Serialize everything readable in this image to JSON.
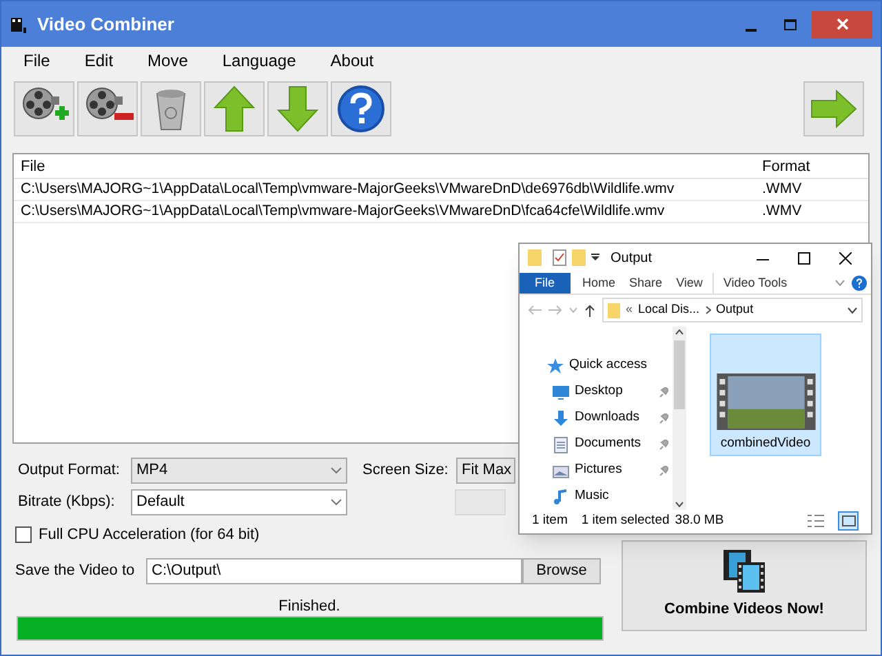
{
  "window": {
    "title": "Video Combiner"
  },
  "menu": [
    "File",
    "Edit",
    "Move",
    "Language",
    "About"
  ],
  "toolbar": [
    {
      "kind": "add"
    },
    {
      "kind": "remove"
    },
    {
      "kind": "clear"
    },
    {
      "kind": "up"
    },
    {
      "kind": "down"
    },
    {
      "kind": "help"
    }
  ],
  "file_list": {
    "columns": [
      "File",
      "Format"
    ],
    "rows": [
      {
        "file": "C:\\Users\\MAJORG~1\\AppData\\Local\\Temp\\vmware-MajorGeeks\\VMwareDnD\\de6976db\\Wildlife.wmv",
        "format": ".WMV"
      },
      {
        "file": "C:\\Users\\MAJORG~1\\AppData\\Local\\Temp\\vmware-MajorGeeks\\VMwareDnD\\fca64cfe\\Wildlife.wmv",
        "format": ".WMV"
      }
    ]
  },
  "output_format": {
    "label": "Output Format:",
    "value": "MP4"
  },
  "screen_size": {
    "label": "Screen Size:",
    "value": "Fit Max"
  },
  "bitrate": {
    "label": "Bitrate (Kbps):",
    "value": "Default"
  },
  "cpu_acceleration": {
    "label": "Full CPU Acceleration (for 64 bit)",
    "checked": false
  },
  "save_to": {
    "label": "Save the Video to",
    "value": "C:\\Output\\",
    "button": "Browse"
  },
  "status": "Finished.",
  "progress": {
    "level": 1
  },
  "combine_button": "Combine Videos Now!",
  "explorer": {
    "title": "Output",
    "ribbon_tabs": [
      {
        "label": "File",
        "selected": true
      },
      {
        "label": "Home",
        "selected": false
      },
      {
        "label": "Share",
        "selected": false
      },
      {
        "label": "View",
        "selected": false
      },
      {
        "label": "Video Tools",
        "selected": false
      }
    ],
    "breadcrumb": {
      "prefix": "«",
      "parts": [
        "Local Dis...",
        "Output"
      ]
    },
    "nav": [
      {
        "label": "Quick access",
        "kind": "star",
        "pinned": false
      },
      {
        "label": "Desktop",
        "kind": "desktop",
        "pinned": true
      },
      {
        "label": "Downloads",
        "kind": "download",
        "pinned": true
      },
      {
        "label": "Documents",
        "kind": "document",
        "pinned": true
      },
      {
        "label": "Pictures",
        "kind": "picture",
        "pinned": true
      },
      {
        "label": "Music",
        "kind": "music",
        "pinned": false
      }
    ],
    "file": {
      "name": "combinedVideo",
      "selected": true
    },
    "status": [
      "1 item",
      "1 item selected",
      "38.0 MB"
    ]
  }
}
